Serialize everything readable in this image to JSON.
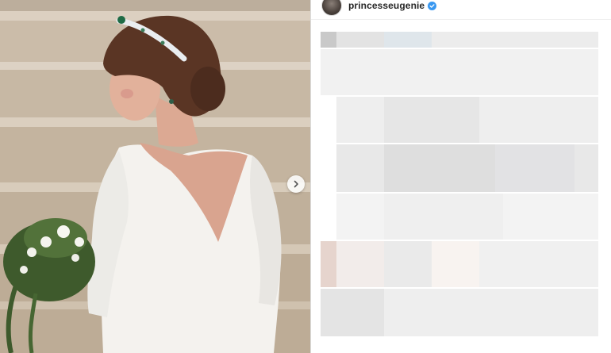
{
  "post": {
    "username": "princesseugenie",
    "verified": true,
    "photo_alt_icon": "photo",
    "carousel_next_icon": "chevron-right-icon"
  },
  "colors": {
    "verified_badge": "#3897f0",
    "username_text": "#262626",
    "divider": "#dbdbdb"
  }
}
